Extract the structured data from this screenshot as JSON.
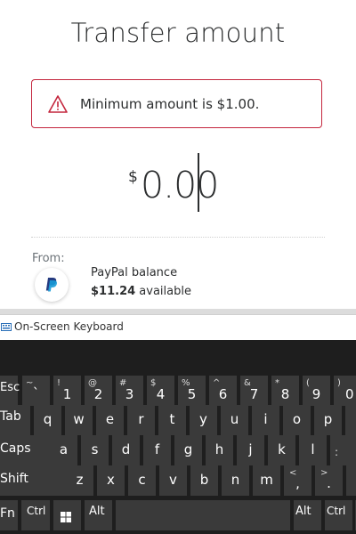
{
  "header": {
    "title": "Transfer amount"
  },
  "alert": {
    "message": "Minimum amount is $1.00."
  },
  "amount": {
    "currency": "$",
    "value": "0.00"
  },
  "from": {
    "label": "From:",
    "account_name": "PayPal balance",
    "balance_amount": "$11.24",
    "balance_suffix": " available"
  },
  "keyboard": {
    "title": "On-Screen Keyboard",
    "row1": [
      {
        "main": "Esc"
      },
      {
        "main": "`",
        "shift": "~"
      },
      {
        "main": "1",
        "shift": "!"
      },
      {
        "main": "2",
        "shift": "@"
      },
      {
        "main": "3",
        "shift": "#"
      },
      {
        "main": "4",
        "shift": "$"
      },
      {
        "main": "5",
        "shift": "%"
      },
      {
        "main": "6",
        "shift": "^"
      },
      {
        "main": "7",
        "shift": "&"
      },
      {
        "main": "8",
        "shift": "*"
      },
      {
        "main": "9",
        "shift": "("
      },
      {
        "main": "0",
        "shift": ")"
      }
    ],
    "row2": [
      "Tab",
      "q",
      "w",
      "e",
      "r",
      "t",
      "y",
      "u",
      "i",
      "o",
      "p"
    ],
    "row3": [
      "Caps",
      "a",
      "s",
      "d",
      "f",
      "g",
      "h",
      "j",
      "k",
      "l"
    ],
    "row4": [
      {
        "main": "Shift"
      },
      {
        "main": "z"
      },
      {
        "main": "x"
      },
      {
        "main": "c"
      },
      {
        "main": "v"
      },
      {
        "main": "b"
      },
      {
        "main": "n"
      },
      {
        "main": "m"
      },
      {
        "main": ",",
        "shift": "<"
      },
      {
        "main": ".",
        "shift": ">"
      }
    ],
    "row5": [
      "Fn",
      "Ctrl",
      "",
      "Alt",
      "",
      "Alt",
      "Ctrl"
    ]
  },
  "colors": {
    "alert_border": "#c4263d",
    "paypal_dark": "#253b80",
    "paypal_light": "#179bd7",
    "key_bg": "#3a3a3a",
    "keyboard_bg": "#1e1e1e"
  }
}
